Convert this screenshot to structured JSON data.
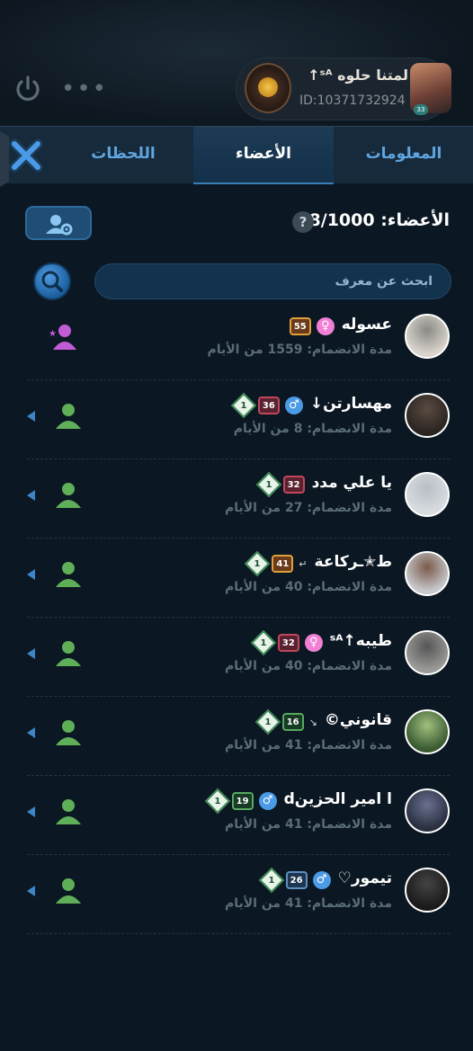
{
  "room": {
    "name": "لمتنا حلوه ˢᴬ↑",
    "id": "ID:10371732924",
    "level_tag": "33"
  },
  "tabs": [
    {
      "label": "المعلومات"
    },
    {
      "label": "الأعضاء"
    },
    {
      "label": "اللحظات"
    }
  ],
  "members_header": {
    "label": "الأعضاء: 8/1000",
    "help": "?"
  },
  "search": {
    "placeholder": "ابحث عن معرف"
  },
  "icons": {
    "power": "power-icon",
    "more": "more-icon",
    "close": "close-icon",
    "help": "question-icon",
    "manage": "member-settings-icon",
    "search": "search-icon",
    "add_member": "add-member-icon",
    "member": "person-icon",
    "expand": "triangle-left-icon"
  },
  "colors": {
    "background": "#0b1722",
    "tab_active": "#123049",
    "accent_blue": "#5fa6e0",
    "member_green": "#5fae58",
    "owner_icon": "#c25cd6"
  },
  "members": [
    {
      "name": "عسوله",
      "joined": "مدة الانضمام: 1559 من الأيام",
      "gender": "♀",
      "gender_type": "female",
      "level": "55",
      "level_style": "gold",
      "diamond": "",
      "extra": "",
      "is_owner": true
    },
    {
      "name": "مهسارتن↓",
      "joined": "مدة الانضمام: 8 من الأيام",
      "gender": "♂",
      "gender_type": "male",
      "level": "36",
      "level_style": "red",
      "diamond": "1",
      "extra": "",
      "is_owner": false
    },
    {
      "name": "يا علي مدد",
      "joined": "مدة الانضمام: 27 من الأيام",
      "gender": "",
      "gender_type": "",
      "level": "32",
      "level_style": "red",
      "diamond": "1",
      "extra": "",
      "is_owner": false
    },
    {
      "name": "ط✭ـركاعة",
      "joined": "مدة الانضمام: 40 من الأيام",
      "gender": "",
      "gender_type": "",
      "level": "41",
      "level_style": "gold",
      "diamond": "1",
      "extra": "↵",
      "is_owner": false
    },
    {
      "name": "طيبه↑ˢᴬ",
      "joined": "مدة الانضمام: 40 من الأيام",
      "gender": "♀",
      "gender_type": "female",
      "level": "32",
      "level_style": "red",
      "diamond": "1",
      "extra": "",
      "is_owner": false
    },
    {
      "name": "قانوني©",
      "joined": "مدة الانضمام: 41 من الأيام",
      "gender": "",
      "gender_type": "",
      "level": "16",
      "level_style": "green",
      "diamond": "1",
      "extra": "↘",
      "is_owner": false
    },
    {
      "name": "ا امير الحزينd",
      "joined": "مدة الانضمام: 41 من الأيام",
      "gender": "♂",
      "gender_type": "male",
      "level": "19",
      "level_style": "green",
      "diamond": "1",
      "extra": "",
      "is_owner": false
    },
    {
      "name": "تيمور♡",
      "joined": "مدة الانضمام: 41 من الأيام",
      "gender": "♂",
      "gender_type": "male",
      "level": "26",
      "level_style": "blue",
      "diamond": "1",
      "extra": "",
      "is_owner": false
    }
  ]
}
